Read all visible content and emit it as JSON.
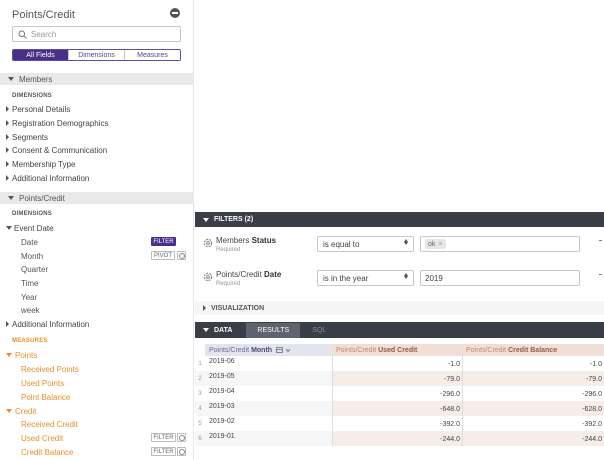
{
  "sidebar": {
    "title": "Points/Credit",
    "search_placeholder": "Search",
    "tabs": [
      "All Fields",
      "Dimensions",
      "Measures"
    ],
    "groups": [
      {
        "label": "Members",
        "dimensions_label": "DIMENSIONS",
        "items": [
          "Personal Details",
          "Registration Demographics",
          "Segments",
          "Consent & Communication",
          "Membership Type",
          "Additional Information"
        ]
      },
      {
        "label": "Points/Credit",
        "dimensions_label": "DIMENSIONS",
        "event_date": {
          "label": "Event Date",
          "children": [
            "Date",
            "Month",
            "Quarter",
            "Time",
            "Year",
            "week"
          ]
        },
        "additional": "Additional Information",
        "measures_label": "MEASURES",
        "points": {
          "label": "Points",
          "children": [
            "Received Points",
            "Used Points",
            "Point Balance"
          ]
        },
        "credit": {
          "label": "Credit",
          "children": [
            "Received Credit",
            "Used Credit",
            "Credit Balance"
          ]
        }
      }
    ],
    "buttons": {
      "filter": "FILTER",
      "pivot": "PIVOT"
    }
  },
  "filters": {
    "header": "FILTERS (2)",
    "rows": [
      {
        "view": "Members",
        "field": "Status",
        "required": "Required",
        "operator": "is equal to",
        "chip": "ok"
      },
      {
        "view": "Points/Credit",
        "field": "Date",
        "required": "Required",
        "operator": "is in the year",
        "value": "2019"
      }
    ]
  },
  "visualization": {
    "label": "VISUALIZATION"
  },
  "data_section": {
    "label": "DATA",
    "tabs": [
      "RESULTS",
      "SQL"
    ]
  },
  "table": {
    "columns": [
      {
        "view": "Points/Credit",
        "field": "Month"
      },
      {
        "view": "Points/Credit",
        "field": "Used Credit"
      },
      {
        "view": "Points/Credit",
        "field": "Credit Balance"
      }
    ],
    "rows": [
      {
        "n": "1",
        "month": "2019-06",
        "used": "-1.0",
        "balance": "-1.0"
      },
      {
        "n": "2",
        "month": "2019-05",
        "used": "-79.0",
        "balance": "-79.0"
      },
      {
        "n": "3",
        "month": "2019-04",
        "used": "-296.0",
        "balance": "-296.0"
      },
      {
        "n": "4",
        "month": "2019-03",
        "used": "-648.0",
        "balance": "-628.0"
      },
      {
        "n": "5",
        "month": "2019-02",
        "used": "-392.0",
        "balance": "-392.0"
      },
      {
        "n": "6",
        "month": "2019-01",
        "used": "-244.0",
        "balance": "-244.0"
      }
    ]
  },
  "colors": {
    "accent": "#4a2e89",
    "header_dark": "#3a3e47",
    "measure_orange": "#e88f2a",
    "dim_header": "#e3e4ec",
    "measure_header": "#f0dfd6"
  }
}
